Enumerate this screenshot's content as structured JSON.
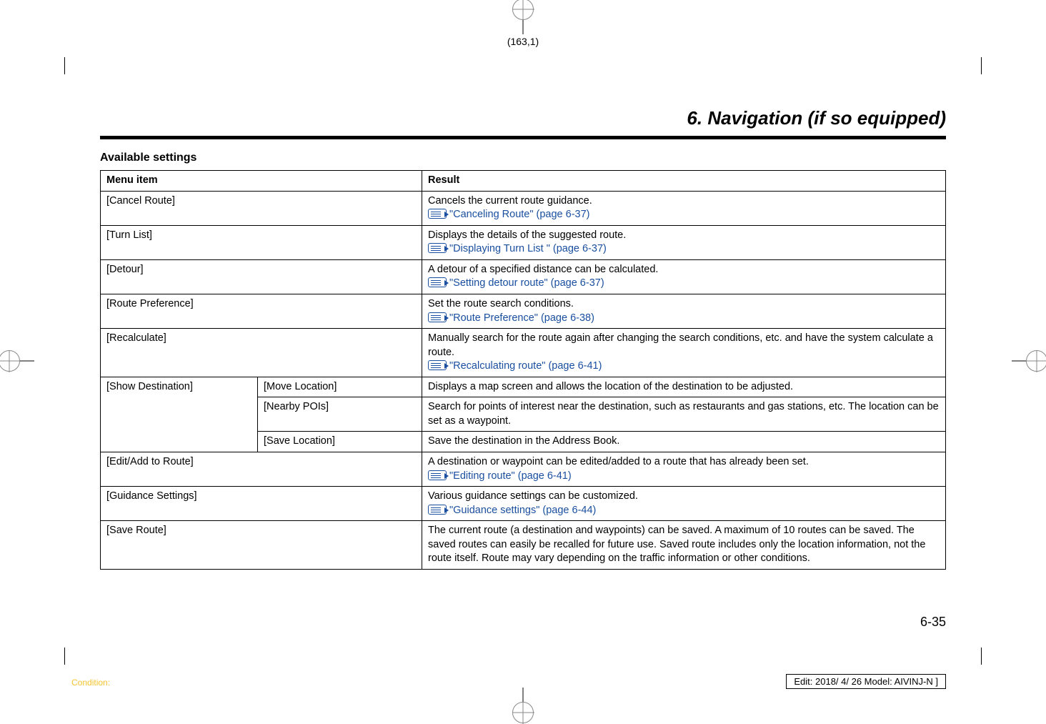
{
  "sheet_ref": "(163,1)",
  "section_title": "6. Navigation (if so equipped)",
  "subheading": "Available settings",
  "headers": {
    "menu": "Menu item",
    "result": "Result"
  },
  "rows": {
    "cancel_route": {
      "menu": "[Cancel Route]",
      "result": "Cancels the current route guidance.",
      "xref": "\"Canceling Route\" (page 6-37)"
    },
    "turn_list": {
      "menu": "[Turn List]",
      "result": "Displays the details of the suggested route.",
      "xref": "\"Displaying Turn List \" (page 6-37)"
    },
    "detour": {
      "menu": "[Detour]",
      "result": "A detour of a specified distance can be calculated.",
      "xref": "\"Setting detour route\" (page 6-37)"
    },
    "route_pref": {
      "menu": "[Route Preference]",
      "result": "Set the route search conditions.",
      "xref": "\"Route Preference\" (page 6-38)"
    },
    "recalc": {
      "menu": "[Recalculate]",
      "result": "Manually search for the route again after changing the search conditions, etc. and have the system calculate a route.",
      "xref": "\"Recalculating route\" (page 6-41)"
    },
    "show_dest": {
      "menu": "[Show Destination]",
      "sub1": "[Move Location]",
      "res1": "Displays a map screen and allows the location of the destination to be adjusted.",
      "sub2": "[Nearby POIs]",
      "res2": "Search for points of interest near the destination, such as restaurants and gas stations, etc. The location can be set as a waypoint.",
      "sub3": "[Save Location]",
      "res3": "Save the destination in the Address Book."
    },
    "edit_add": {
      "menu": "[Edit/Add to Route]",
      "result": "A destination or waypoint can be edited/added to a route that has already been set.",
      "xref": "\"Editing route\" (page 6-41)"
    },
    "guidance": {
      "menu": "[Guidance Settings]",
      "result": "Various guidance settings can be customized.",
      "xref": "\"Guidance settings\" (page 6-44)"
    },
    "save_route": {
      "menu": "[Save Route]",
      "result": "The current route (a destination and waypoints) can be saved. A maximum of 10 routes can be saved. The saved routes can easily be recalled for future use. Saved route includes only the location information, not the route itself. Route may vary depending on the traffic information or other conditions."
    }
  },
  "page_number": "6-35",
  "condition_label": "Condition:",
  "edit_stamp": "Edit: 2018/ 4/ 26    Model:  AIVINJ-N ]"
}
